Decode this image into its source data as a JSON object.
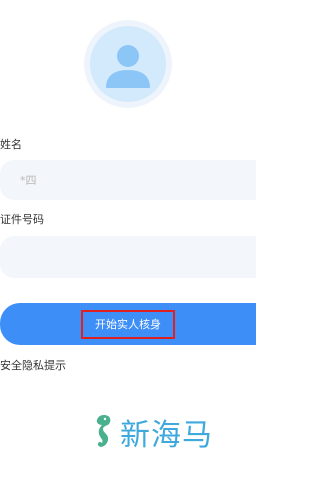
{
  "form": {
    "name_label": "姓名",
    "name_value": "*四",
    "id_label": "证件号码",
    "id_value": "",
    "start_button_label": "开始实人核身",
    "privacy_text": "安全隐私提示"
  },
  "watermark": {
    "text": "新海马",
    "color": "#1e9bd8"
  },
  "colors": {
    "primary": "#3d8ef7",
    "highlight_border": "#e02020",
    "field_bg": "#f3f6fa"
  }
}
